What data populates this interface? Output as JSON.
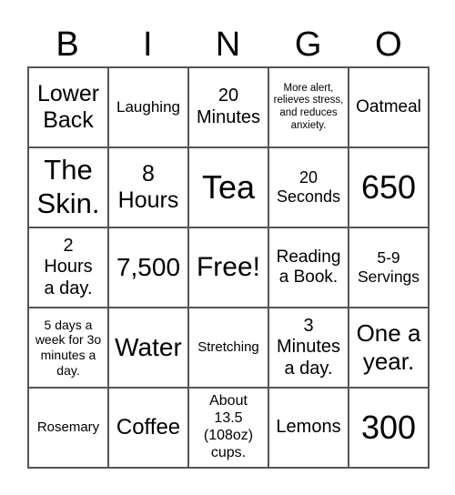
{
  "header": [
    "B",
    "I",
    "N",
    "G",
    "O"
  ],
  "cells": [
    [
      "Lower Back",
      "Laughing",
      "20 Minutes",
      "More alert, relieves stress, and reduces anxiety.",
      "Oatmeal"
    ],
    [
      "The Skin.",
      "8 Hours",
      "Tea",
      "20 Seconds",
      "650"
    ],
    [
      "2 Hours a day.",
      "7,500",
      "Free!",
      "Reading a Book.",
      "5-9 Servings"
    ],
    [
      "5 days a week for 3o minutes a day.",
      "Water",
      "Stretching",
      "3 Minutes a day.",
      "One a year."
    ],
    [
      "Rosemary",
      "Coffee",
      "About 13.5 (108oz) cups.",
      "Lemons",
      "300"
    ]
  ]
}
